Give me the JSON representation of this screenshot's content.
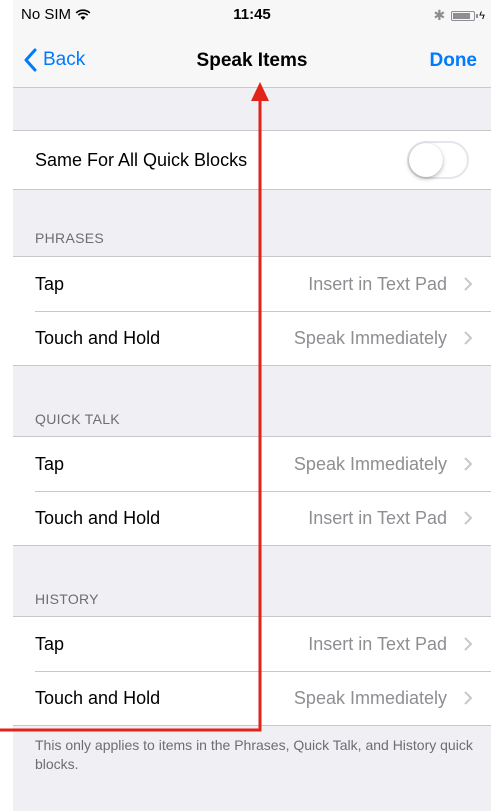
{
  "status_bar": {
    "carrier": "No SIM",
    "time": "11:45"
  },
  "nav": {
    "back_label": "Back",
    "title": "Speak Items",
    "done_label": "Done"
  },
  "settings": {
    "same_for_all_label": "Same For All Quick Blocks",
    "same_for_all_on": false
  },
  "sections": [
    {
      "header": "PHRASES",
      "rows": [
        {
          "label": "Tap",
          "value": "Insert in Text Pad"
        },
        {
          "label": "Touch and Hold",
          "value": "Speak Immediately"
        }
      ]
    },
    {
      "header": "QUICK TALK",
      "rows": [
        {
          "label": "Tap",
          "value": "Speak Immediately"
        },
        {
          "label": "Touch and Hold",
          "value": "Insert in Text Pad"
        }
      ]
    },
    {
      "header": "HISTORY",
      "rows": [
        {
          "label": "Tap",
          "value": "Insert in Text Pad"
        },
        {
          "label": "Touch and Hold",
          "value": "Speak Immediately"
        }
      ]
    }
  ],
  "footer": "This only applies to items in the Phrases, Quick Talk, and History quick blocks.",
  "colors": {
    "accent": "#007aff",
    "annotation": "#e2231a",
    "secondary_text": "#8e8e93",
    "background": "#efeff4"
  }
}
